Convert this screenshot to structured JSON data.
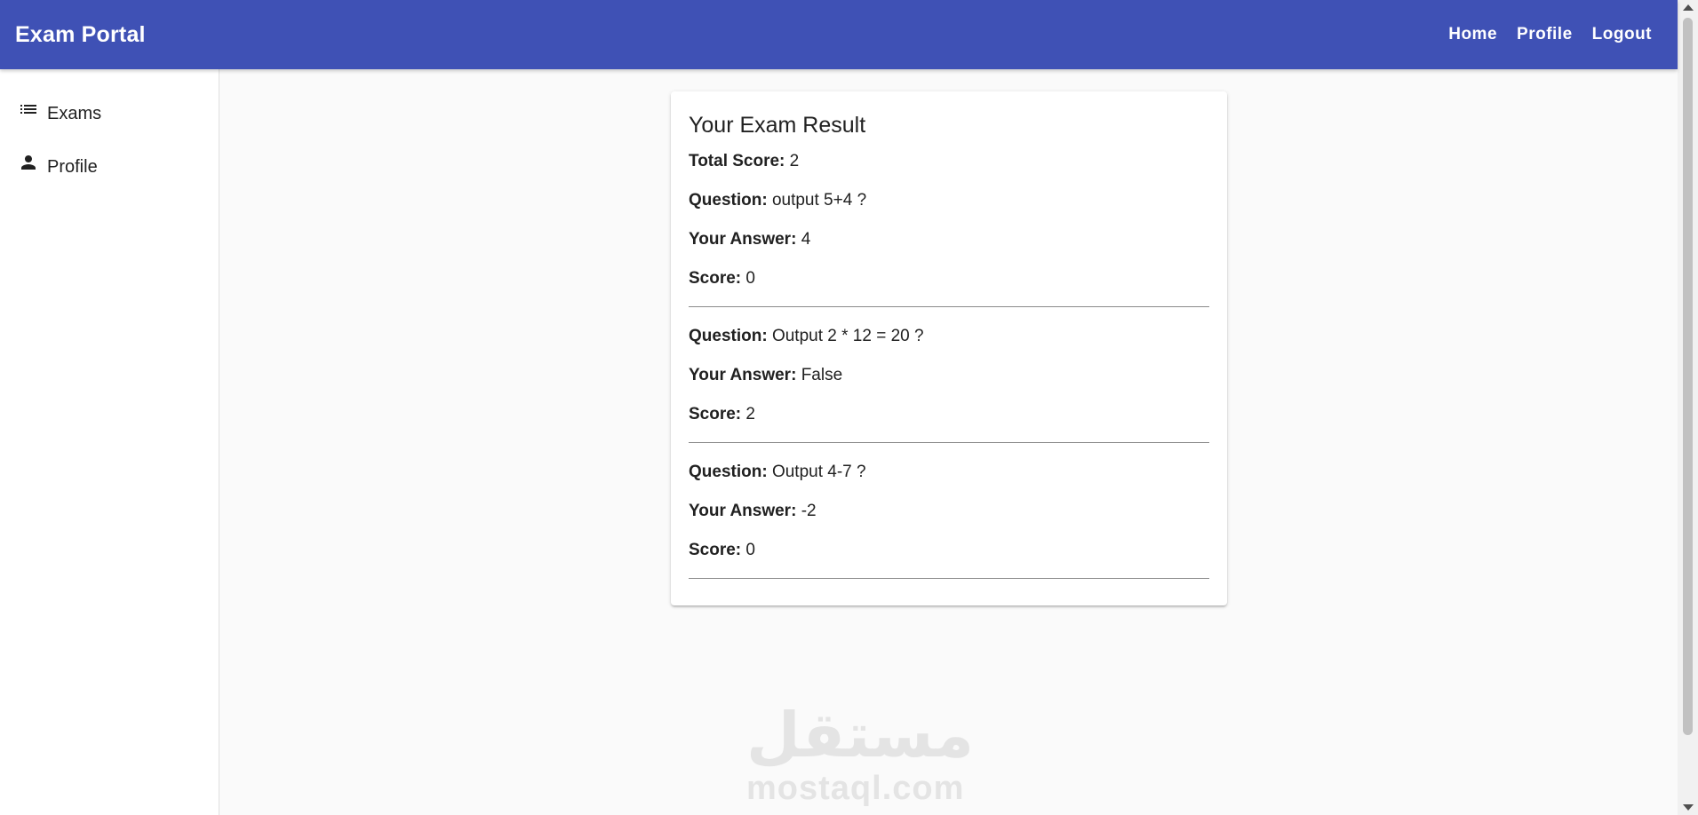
{
  "header": {
    "title": "Exam Portal",
    "nav": [
      "Home",
      "Profile",
      "Logout"
    ]
  },
  "sidebar": {
    "items": [
      {
        "label": "Exams",
        "icon": "list-icon"
      },
      {
        "label": "Profile",
        "icon": "person-icon"
      }
    ]
  },
  "result": {
    "title": "Your Exam Result",
    "total_label": "Total Score:",
    "total_value": "2",
    "question_label": "Question:",
    "answer_label": "Your Answer:",
    "score_label": "Score:",
    "items": [
      {
        "question": "output 5+4 ?",
        "answer": "4",
        "score": "0"
      },
      {
        "question": "Output 2 * 12 = 20 ?",
        "answer": "False",
        "score": "2"
      },
      {
        "question": "Output 4-7 ?",
        "answer": "-2",
        "score": "0"
      }
    ]
  },
  "watermark": {
    "arabic": "مستقل",
    "latin": "mostaql.com"
  },
  "colors": {
    "primary": "#3f51b5",
    "background": "#fafafa"
  }
}
